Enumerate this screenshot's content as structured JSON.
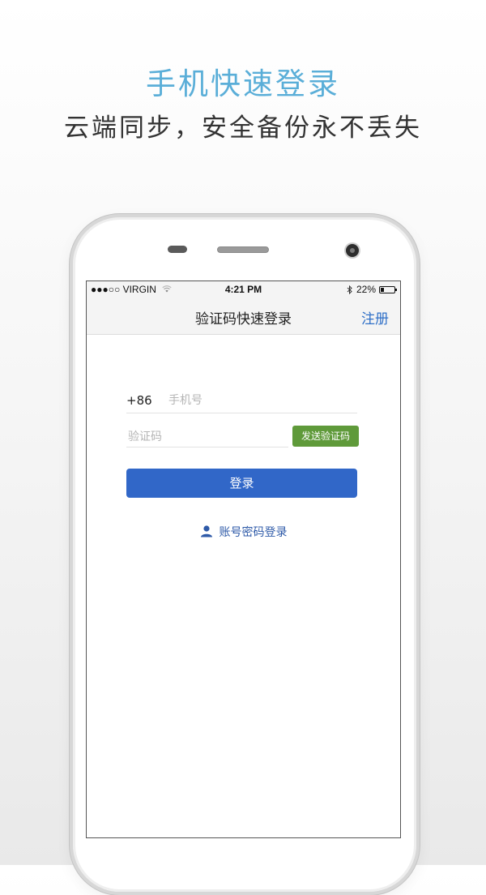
{
  "promo": {
    "title": "手机快速登录",
    "subtitle": "云端同步，安全备份永不丢失"
  },
  "status_bar": {
    "carrier": "●●●○○ VIRGIN",
    "time": "4:21 PM",
    "battery": "22%",
    "battery_level": 0.22,
    "icons": [
      "wifi-icon",
      "bluetooth-icon",
      "battery-icon"
    ]
  },
  "nav": {
    "title": "验证码快速登录",
    "register_label": "注册"
  },
  "form": {
    "country_code": "+86",
    "phone_placeholder": "手机号",
    "phone_value": "",
    "code_placeholder": "验证码",
    "code_value": "",
    "send_code_label": "发送验证码",
    "login_label": "登录",
    "password_login_label": "账号密码登录"
  },
  "colors": {
    "title": "#5aaed8",
    "accent_blue": "#3167c8",
    "send_green": "#5f9a3a",
    "link_blue": "#2e5aa8"
  }
}
